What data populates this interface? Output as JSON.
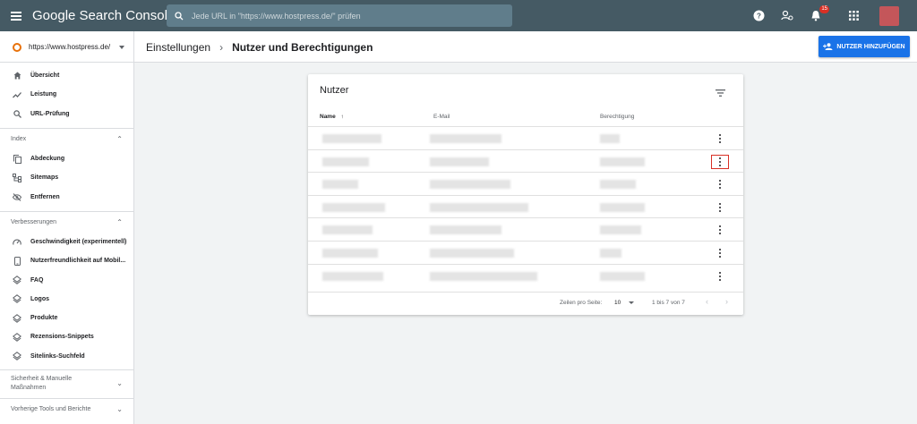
{
  "app": {
    "title": "Google Search Console"
  },
  "search": {
    "placeholder": "Jede URL in \"https://www.hostpress.de/\" prüfen"
  },
  "topbar": {
    "notification_count": "15"
  },
  "property": {
    "url": "https://www.hostpress.de/"
  },
  "breadcrumb": {
    "parent": "Einstellungen",
    "current": "Nutzer und Berechtigungen"
  },
  "actions": {
    "add_user": "NUTZER HINZUFÜGEN"
  },
  "sidebar": {
    "top_items": [
      {
        "label": "Übersicht",
        "icon": "home-icon"
      },
      {
        "label": "Leistung",
        "icon": "trending-icon"
      },
      {
        "label": "URL-Prüfung",
        "icon": "search-icon"
      }
    ],
    "index": {
      "title": "Index",
      "items": [
        {
          "label": "Abdeckung",
          "icon": "copy-icon"
        },
        {
          "label": "Sitemaps",
          "icon": "sitemap-icon"
        },
        {
          "label": "Entfernen",
          "icon": "eye-off-icon"
        }
      ]
    },
    "improvements": {
      "title": "Verbesserungen",
      "items": [
        {
          "label": "Geschwindigkeit (experimentell)",
          "icon": "speed-icon"
        },
        {
          "label": "Nutzerfreundlichkeit auf Mobil...",
          "icon": "phone-icon"
        },
        {
          "label": "FAQ",
          "icon": "layers-icon"
        },
        {
          "label": "Logos",
          "icon": "layers-icon"
        },
        {
          "label": "Produkte",
          "icon": "layers-icon"
        },
        {
          "label": "Rezensions-Snippets",
          "icon": "layers-icon"
        },
        {
          "label": "Sitelinks-Suchfeld",
          "icon": "layers-icon"
        }
      ]
    },
    "security": {
      "title": "Sicherheit & Manuelle Maßnahmen"
    },
    "legacy": {
      "title": "Vorherige Tools und Berichte"
    }
  },
  "card": {
    "title": "Nutzer",
    "columns": {
      "name": "Name",
      "email": "E-Mail",
      "permission": "Berechtigung"
    },
    "sort_indicator": "↑",
    "row_count": 7,
    "pager": {
      "rows_label": "Zeilen pro Seite:",
      "rows_value": "10",
      "range": "1 bis 7 von 7"
    }
  },
  "colors": {
    "topbar": "#455a64",
    "accent": "#1a73e8",
    "highlight": "#d93025"
  }
}
